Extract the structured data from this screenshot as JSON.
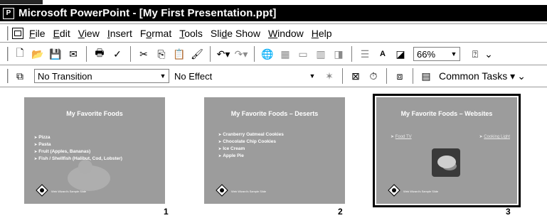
{
  "window": {
    "title": "Microsoft PowerPoint - [My First Presentation.ppt]",
    "app_icon": "powerpoint-icon"
  },
  "menu": [
    {
      "label": "File",
      "accel": "F"
    },
    {
      "label": "Edit",
      "accel": "E"
    },
    {
      "label": "View",
      "accel": "V"
    },
    {
      "label": "Insert",
      "accel": "I"
    },
    {
      "label": "Format",
      "accel": "o"
    },
    {
      "label": "Tools",
      "accel": "T"
    },
    {
      "label": "Slide Show",
      "accel": "d"
    },
    {
      "label": "Window",
      "accel": "W"
    },
    {
      "label": "Help",
      "accel": "H"
    }
  ],
  "standard_toolbar": {
    "zoom": "66%"
  },
  "slide_sorter_toolbar": {
    "transition": "No Transition",
    "effect": "No Effect",
    "common_tasks": "Common Tasks"
  },
  "slides": [
    {
      "number": "1",
      "title": "My Favorite Foods",
      "bullets": [
        "Pizza",
        "Pasta",
        "Fruit (Apples, Bananas)",
        "Fish / Shellfish (Halibut, Cod, Lobster)"
      ],
      "footer": "Web Wizard's Sample Slide",
      "selected": false
    },
    {
      "number": "2",
      "title": "My Favorite Foods – Deserts",
      "bullets": [
        "Cranberry Oatmeal Cookies",
        "Chocolate Chip Cookies",
        "Ice Cream",
        "Apple Pie"
      ],
      "footer": "Web Wizard's Sample Slide",
      "selected": false
    },
    {
      "number": "3",
      "title": "My Favorite Foods – Websites",
      "links": [
        "Food TV",
        "Cooking Light"
      ],
      "footer": "Web Wizard's Sample Slide",
      "selected": true
    }
  ]
}
